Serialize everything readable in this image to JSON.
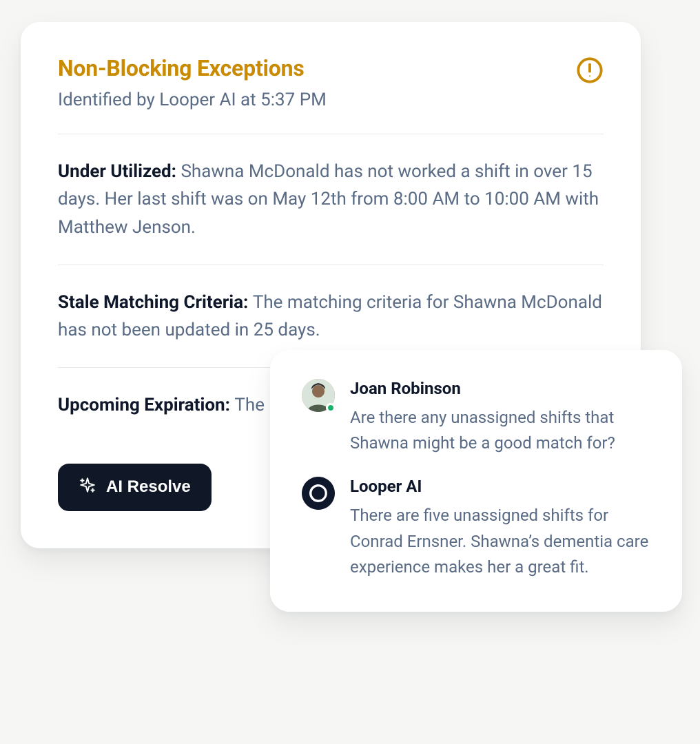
{
  "exceptions": {
    "title": "Non-Blocking Exceptions",
    "subtitle": "Identified by Looper AI at 5:37 PM",
    "items": [
      {
        "label": "Under Utilized: ",
        "body": "Shawna McDonald has not worked a shift in over 15 days. Her last shift was on May 12th from 8:00 AM to 10:00 AM with Matthew Jenson."
      },
      {
        "label": "Stale Matching Criteria: ",
        "body": "The matching criteria for Shawna McDonald has not been updated in 25 days."
      },
      {
        "label": "Upcoming Expiration: ",
        "body": "The ID for Shawna McDonald is set to expire."
      }
    ],
    "resolve_label": "AI Resolve"
  },
  "chat": {
    "messages": [
      {
        "author": "Joan Robinson",
        "text": "Are there any unassigned shifts that Shawna might be a good match for?"
      },
      {
        "author": "Looper AI",
        "text": "There are five unassigned shifts for Conrad Ernsner. Shawna’s dementia care experience makes her a great fit."
      }
    ]
  },
  "colors": {
    "accent_warn": "#c98a04",
    "text_muted": "#5a6b85",
    "button_bg": "#101828",
    "presence": "#17b26a"
  }
}
